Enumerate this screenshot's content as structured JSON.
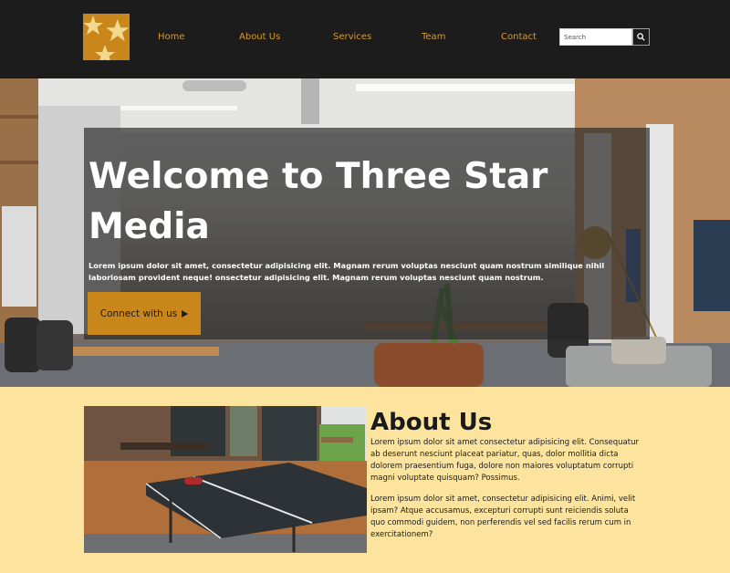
{
  "header": {
    "logo_icon": "three-stars-logo",
    "nav": {
      "home": "Home",
      "about": "About Us",
      "services": "Services",
      "team": "Team",
      "contact": "Contact"
    },
    "search": {
      "placeholder": "Search",
      "icon": "search-icon"
    }
  },
  "hero": {
    "title": "Welcome to Three Star Media",
    "text": "Lorem ipsum dolor sit amet, consectetur adipisicing elit. Magnam rerum voluptas nesciunt quam nostrum similique nihil laboriosam provident neque! onsectetur adipisicing elit. Magnam rerum voluptas nesciunt quam nostrum.",
    "cta_label": "Connect with us",
    "cta_icon": "play-icon"
  },
  "about": {
    "title": "About Us",
    "paragraph1": "Lorem ipsum dolor sit amet consectetur adipisicing elit. Consequatur ab deserunt nesciunt placeat pariatur, quas, dolor mollitia dicta dolorem praesentium fuga, dolore non maiores voluptatum corrupti magni voluptate quisquam? Possimus.",
    "paragraph2": "Lorem ipsum dolor sit amet, consectetur adipisicing elit. Animi, velit ipsam? Atque accusamus, excepturi corrupti sunt reiciendis soluta quo commodi guidem, non perferendis vel sed facilis rerum cum in exercitationem?"
  },
  "colors": {
    "header_bg": "#1c1c1c",
    "accent": "#c8861b",
    "nav_text": "#d99a2b",
    "page_bg": "#fde49e"
  }
}
